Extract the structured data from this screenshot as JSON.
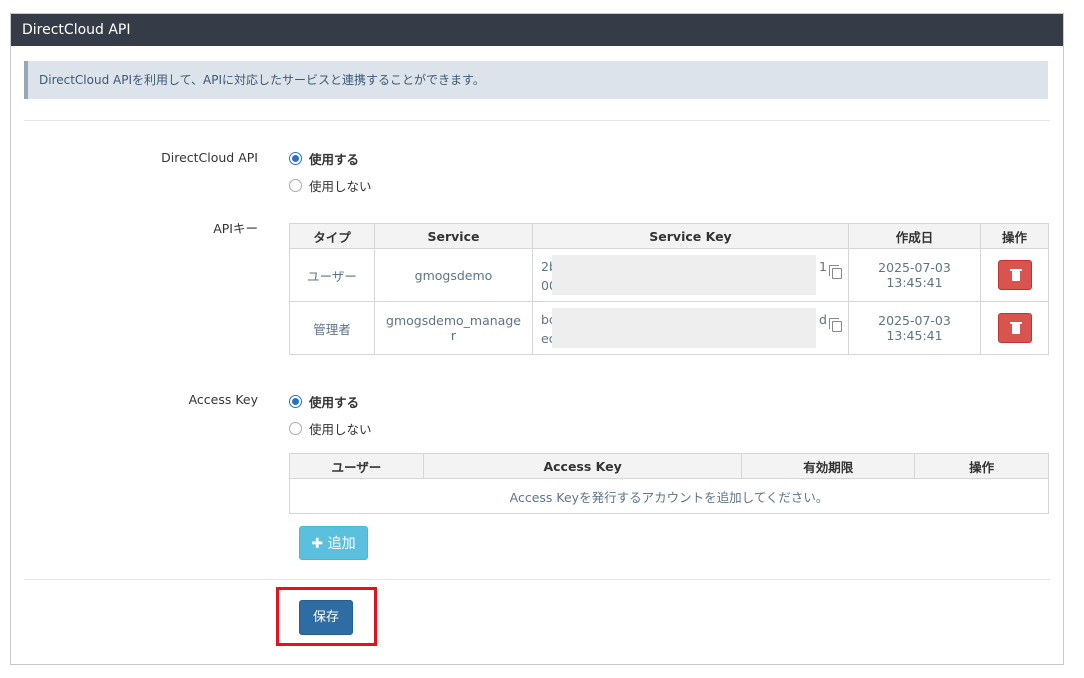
{
  "panel": {
    "title": "DirectCloud API"
  },
  "info": {
    "text": "DirectCloud APIを利用して、APIに対応したサービスと連携することができます。"
  },
  "directcloud_api": {
    "label": "DirectCloud API",
    "options": [
      "使用する",
      "使用しない"
    ],
    "selected": "使用する"
  },
  "api_keys": {
    "label": "APIキー",
    "headers": [
      "タイプ",
      "Service",
      "Service Key",
      "作成日",
      "操作"
    ],
    "rows": [
      {
        "type": "ユーザー",
        "service": "gmogsdemo",
        "key_start_1": "2b",
        "key_start_2": "00",
        "key_end_1": "1",
        "key_end_2": "",
        "created_1": "2025-07-03",
        "created_2": "13:45:41"
      },
      {
        "type": "管理者",
        "service": "gmogsdemo_manage",
        "service_2": "r",
        "key_start_1": "bc",
        "key_start_2": "ec",
        "key_end_1": "d",
        "key_end_2": "",
        "created_1": "2025-07-03",
        "created_2": "13:45:41"
      }
    ]
  },
  "access_key": {
    "label": "Access Key",
    "options": [
      "使用する",
      "使用しない"
    ],
    "selected": "使用する",
    "headers": [
      "ユーザー",
      "Access Key",
      "有効期限",
      "操作"
    ],
    "empty_text": "Access Keyを発行するアカウントを追加してください。",
    "add_button": "追加",
    "add_icon": "plus-icon"
  },
  "save_button": "保存",
  "colors": {
    "header_bg": "#353c48",
    "primary": "#2e6da4",
    "info_btn": "#5bc0de",
    "danger": "#d9534f",
    "highlight": "#e0141e"
  }
}
